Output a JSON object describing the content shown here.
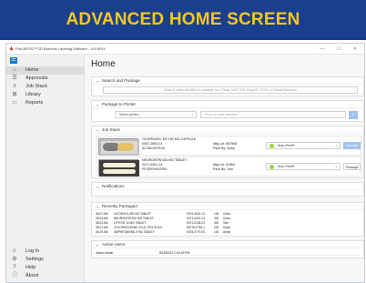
{
  "banner": {
    "title": "ADVANCED HOME SCREEN"
  },
  "window": {
    "title": "Pub-BOSS™ 2D Barcode Labeling Software - v10.6Pr3",
    "controls": "—  ☐  ✕"
  },
  "sidebar": {
    "menu_icon": "☰",
    "items": [
      {
        "label": "Home",
        "icon": "home-icon",
        "glyph": "⌂"
      },
      {
        "label": "Approvals",
        "icon": "approvals-icon",
        "glyph": "☰"
      },
      {
        "label": "Job Stack",
        "icon": "job-stack-icon",
        "glyph": "≡"
      },
      {
        "label": "Library",
        "icon": "library-icon",
        "glyph": "⊞"
      },
      {
        "label": "Reports",
        "icon": "reports-icon",
        "glyph": "▭"
      }
    ],
    "footer": [
      {
        "label": "Log In",
        "icon": "user-icon",
        "glyph": "☺"
      },
      {
        "label": "Settings",
        "icon": "gear-icon",
        "glyph": "⚙"
      },
      {
        "label": "Help",
        "icon": "help-icon",
        "glyph": "?"
      },
      {
        "label": "About",
        "icon": "info-icon",
        "glyph": "ⓘ"
      }
    ]
  },
  "main": {
    "title": "Home",
    "search_package": {
      "title": "Search and Package",
      "placeholder": "Scan or enter identifier to package (ex: Fiscal, NDC, EN, Drug ID, GTIN, or Recall Barcode)"
    },
    "package_to_printer": {
      "title": "Package to Printer",
      "printer_placeholder": "Select printer...",
      "identifier_placeholder": "Scan or enter identifier",
      "search_glyph": "⌕"
    },
    "job_stack": {
      "title": "Job Stack",
      "jobs": [
        {
          "drug_lines": [
            "OXAPRAZIN, ER 150 MG CAPSULE",
            "0067-2800-01",
            "ACTAVIS/TEVA"
          ],
          "lot": "Mfg Lot: 987568",
          "packer": "Pack By: Vicky",
          "auto_print": "Auto-Print®",
          "button": "Package",
          "button_active": false
        },
        {
          "drug_lines": [
            "NEURONTIN 600 MG TABLET",
            "0071-0401-24",
            "PFIZER/VIATRIS"
          ],
          "lot": "Mfg Lot: 51564",
          "packer": "Pack By: Tom",
          "auto_print": "Auto-Print®",
          "button": "Package",
          "button_active": true
        }
      ]
    },
    "notifications": {
      "title": "Notifications"
    },
    "recently_packaged": {
      "title": "Recently Packaged",
      "rows": [
        [
          "08:27 AM",
          "VICODIN 5-300 MG TABLET",
          "0074-3041-13",
          "100",
          "Clara"
        ],
        [
          "08:26 AM",
          "NEURONTIN 600 MG TABLET",
          "0071-0401-24",
          "300",
          "Clara"
        ],
        [
          "08:24 AM",
          "LIPITOR 10 MG TABLET",
          "0071-0155-23",
          "400",
          "Tom"
        ],
        [
          "08:21 AM",
          "CHLORHEXIDINE GLUC 20% SOLN",
          "58778-2735-1",
          "200",
          "Clara"
        ],
        [
          "08:19 AM",
          "AMPHETAMINE-5 MG TABLET",
          "0378-4770-93",
          "100",
          "Anton"
        ]
      ]
    },
    "active_users": {
      "title": "Active Users",
      "rows": [
        {
          "name": "Adam Admin",
          "time": "8/18/2022 1:00:15 PM"
        }
      ]
    }
  },
  "colors": {
    "banner_bg": "#1a3f8f",
    "banner_text": "#f7c81e",
    "accent": "#1a73e8",
    "status_dot": "#9ed63a"
  }
}
